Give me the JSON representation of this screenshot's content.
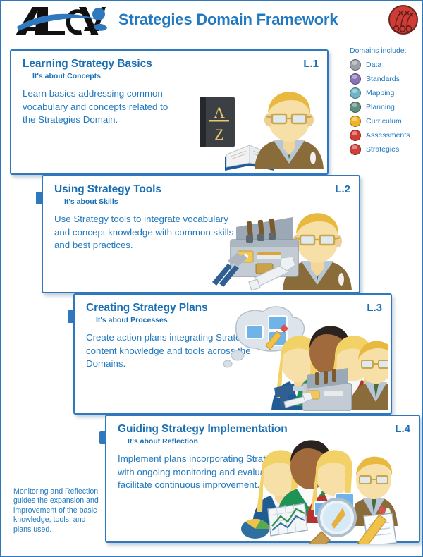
{
  "header": {
    "logo_alt": "ALCA",
    "title": "Strategies Domain Framework",
    "badge_alt": "Strategies domain badge"
  },
  "legend": {
    "title": "Domains include:",
    "items": [
      {
        "label": "Data",
        "color": "#9aa0a6"
      },
      {
        "label": "Standards",
        "color": "#8a72b8"
      },
      {
        "label": "Mapping",
        "color": "#6fb3c4"
      },
      {
        "label": "Planning",
        "color": "#5e8f7e"
      },
      {
        "label": "Curriculum",
        "color": "#f0b429"
      },
      {
        "label": "Assessments",
        "color": "#cf3d34"
      },
      {
        "label": "Strategies",
        "color": "#d0403a"
      }
    ]
  },
  "cards": [
    {
      "code": "L.1",
      "title": "Learning Strategy Basics",
      "subtitle": "It's about Concepts",
      "body": "Learn basics addressing common vocabulary and concepts related to the Strategies Domain.",
      "art_alt": "Man with dictionary and open book"
    },
    {
      "code": "L.2",
      "title": "Using Strategy Tools",
      "subtitle": "It's about Skills",
      "body": "Use Strategy tools to integrate vocabulary and concept knowledge with common skills and best practices.",
      "art_alt": "Man with open toolbox, pliers and wrench"
    },
    {
      "code": "L.3",
      "title": "Creating Strategy Plans",
      "subtitle": "It's about Processes",
      "body": "Create action plans integrating Strategies content knowledge and tools across the Domains.",
      "art_alt": "Team of four with thought bubble and toolbox"
    },
    {
      "code": "L.4",
      "title": "Guiding Strategy Implementation",
      "subtitle": "It's about Reflection",
      "body": "Implement plans incorporating Strategies with ongoing monitoring and evaluation to facilitate continuous improvement.",
      "art_alt": "Team of four with charts, magnifier and notepad"
    }
  ],
  "footer": {
    "note": "Monitoring and Reflection guides the expansion and improvement of the basic knowledge, tools, and plans used."
  },
  "colors": {
    "accent_blue": "#2279bf",
    "card_border": "#2f78bd",
    "title_blue": "#1a6fb5",
    "badge_red": "#cf3c36"
  }
}
